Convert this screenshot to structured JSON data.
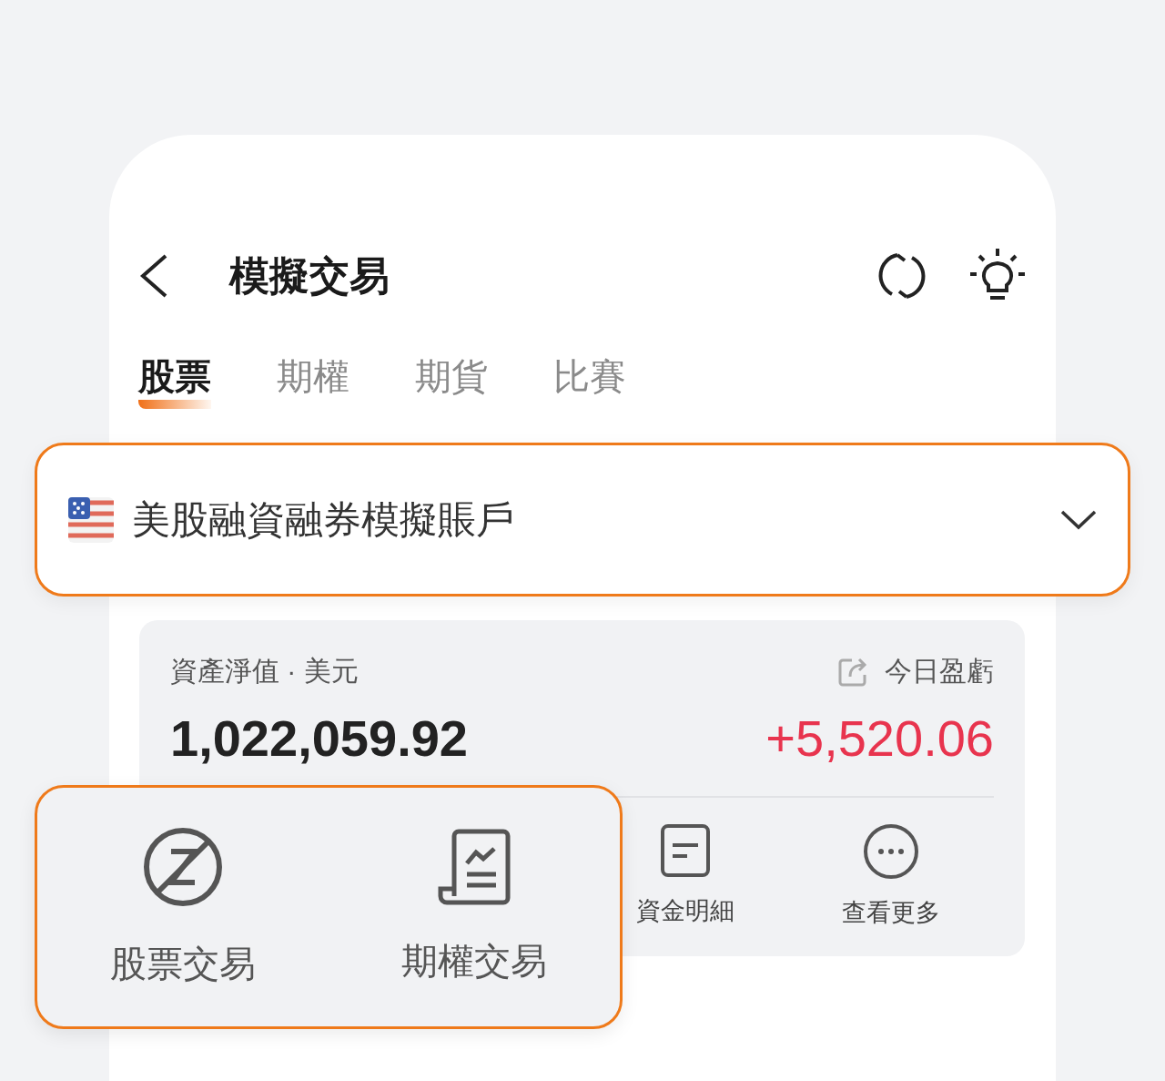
{
  "header": {
    "title": "模擬交易"
  },
  "tabs": [
    {
      "label": "股票",
      "selected": true
    },
    {
      "label": "期權",
      "selected": false
    },
    {
      "label": "期貨",
      "selected": false
    },
    {
      "label": "比賽",
      "selected": false
    }
  ],
  "account_selector": {
    "name": "美股融資融券模擬賬戶"
  },
  "asset_card": {
    "label": "資產淨值 · 美元",
    "net_value": "1,022,059.92",
    "pnl_label": "今日盈虧",
    "pnl": "+5,520.06",
    "actions": [
      {
        "label": "資金明細",
        "kind": "statement"
      },
      {
        "label": "查看更多",
        "kind": "more"
      }
    ]
  },
  "callout_actions": [
    {
      "label": "股票交易",
      "kind": "stock"
    },
    {
      "label": "期權交易",
      "kind": "options"
    }
  ]
}
